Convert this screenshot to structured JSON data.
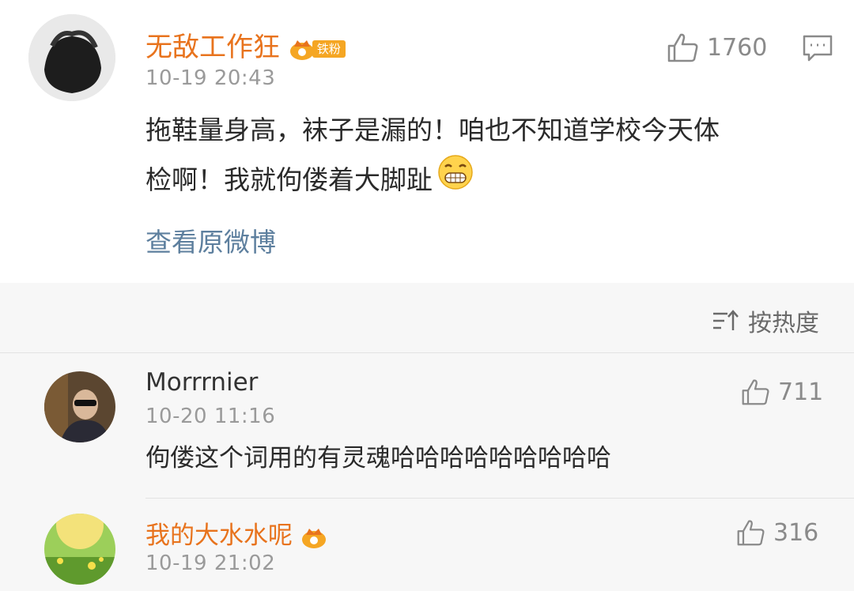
{
  "post": {
    "username": "无敌工作狂",
    "fan_badge": "铁粉",
    "time": "10-19 20:43",
    "like_count": "1760",
    "text_line1": "拖鞋量身高，袜子是漏的！咱也不知道学校今天体",
    "text_line2": "检啊！我就佝偻着大脚趾",
    "view_original": "查看原微博"
  },
  "sort": {
    "label": "按热度"
  },
  "comments": [
    {
      "username": "Morrrnier",
      "time": "10-20 11:16",
      "text": "佝偻这个词用的有灵魂哈哈哈哈哈哈哈哈哈",
      "like_count": "711"
    },
    {
      "username": "我的大水水呢",
      "time": "10-19 21:02",
      "text": "",
      "like_count": "316"
    }
  ],
  "colors": {
    "username_orange": "#e8731d",
    "link_blue": "#5d7f9e",
    "meta_gray": "#9a9a9a",
    "badge_gold": "#f5a623"
  },
  "icons": [
    "thumb-up-icon",
    "comment-icon",
    "sort-icon",
    "crown-badge-icon",
    "grin-emoji-icon"
  ]
}
